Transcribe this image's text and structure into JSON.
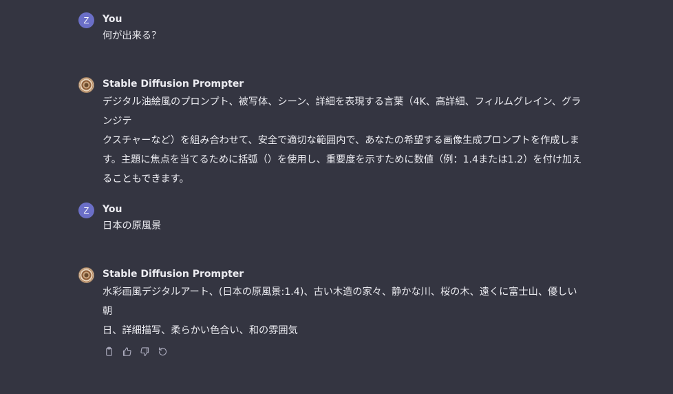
{
  "messages": [
    {
      "role": "user",
      "author": "You",
      "avatar_letter": "Z",
      "text": "何が出来る？"
    },
    {
      "role": "assistant",
      "author": "Stable Diffusion Prompter",
      "text": "デジタル油絵風のプロンプト、被写体、シーン、詳細を表現する言葉（4K、高詳細、フィルムグレイン、グランジテ\nクスチャーなど）を組み合わせて、安全で適切な範囲内で、あなたの希望する画像生成プロンプトを作成しま\nす。主題に焦点を当てるために括弧（）を使用し、重要度を示すために数値（例：1.4または1.2）を付け加え\nることもできます。"
    },
    {
      "role": "user",
      "author": "You",
      "avatar_letter": "Z",
      "text": "日本の原風景"
    },
    {
      "role": "assistant",
      "author": "Stable Diffusion Prompter",
      "text": "水彩画風デジタルアート、(日本の原風景:1.4)、古い木造の家々、静かな川、桜の木、遠くに富士山、優しい朝\n日、詳細描写、柔らかい色合い、和の雰囲気"
    }
  ],
  "actions": [
    {
      "icon": "clipboard-icon"
    },
    {
      "icon": "thumbs-up-icon"
    },
    {
      "icon": "thumbs-down-icon"
    },
    {
      "icon": "regenerate-icon"
    }
  ],
  "colors": {
    "background": "#343541",
    "text": "#ececf1",
    "user_avatar": "#6b6fc7",
    "icon": "#acacbe"
  }
}
